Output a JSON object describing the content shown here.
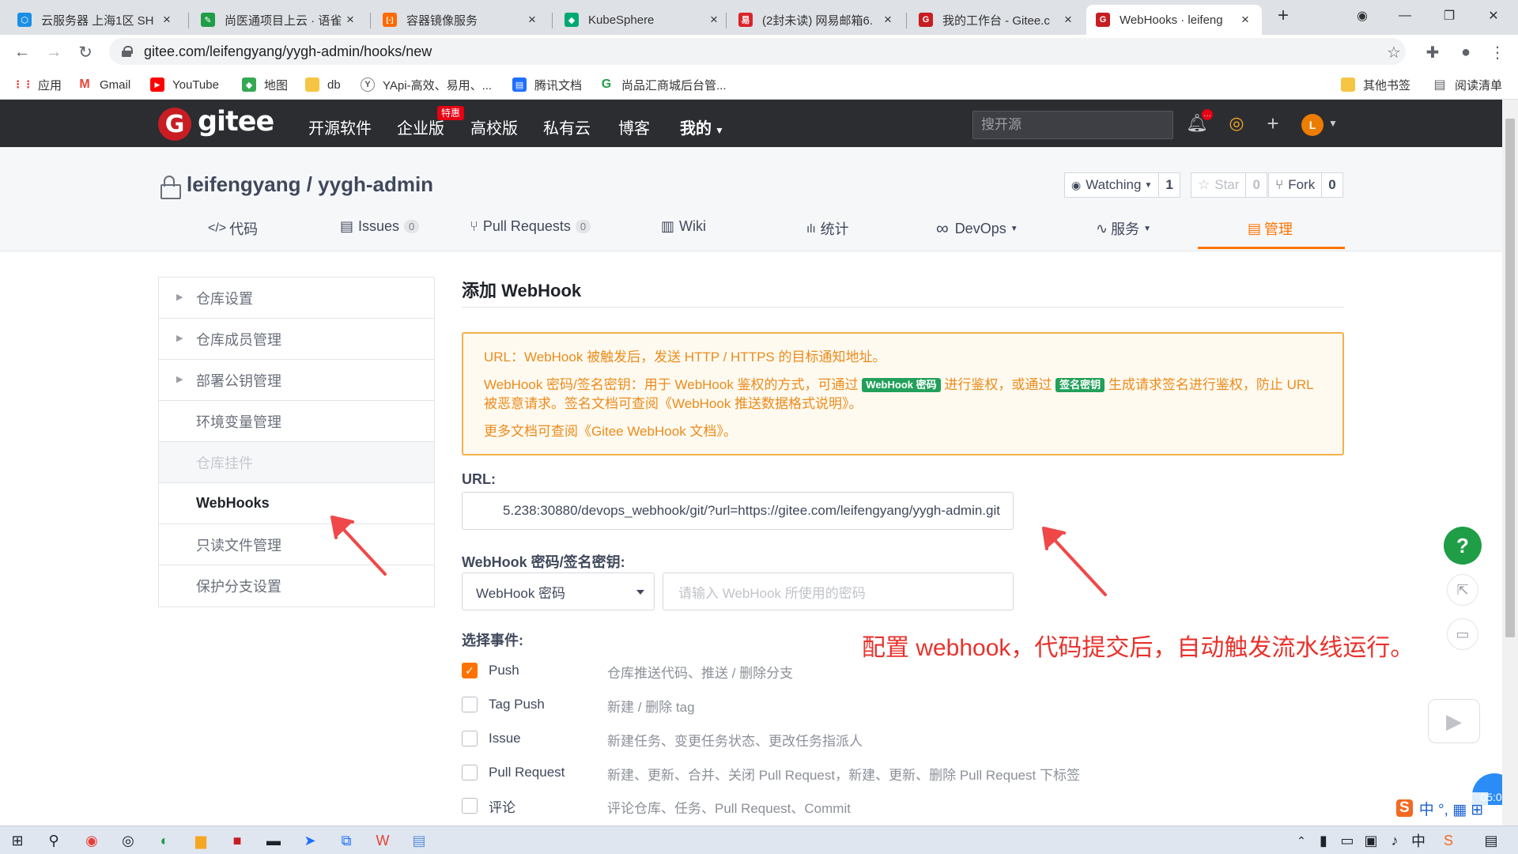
{
  "browser": {
    "tabs": [
      {
        "label": "云服务器 上海1区 SH",
        "favicon_color": "#1b8fe6",
        "favicon_glyph": "⬡"
      },
      {
        "label": "尚医通项目上云 · 语雀",
        "favicon_color": "#1f9d47",
        "favicon_glyph": "✎"
      },
      {
        "label": "容器镜像服务",
        "favicon_color": "#ff6a00",
        "favicon_glyph": "[-]"
      },
      {
        "label": "KubeSphere",
        "favicon_color": "#00a971",
        "favicon_glyph": "◆"
      },
      {
        "label": "(2封未读) 网易邮箱6.",
        "favicon_color": "#d9252a",
        "favicon_glyph": "易"
      },
      {
        "label": "我的工作台 - Gitee.c",
        "favicon_color": "#c71d23",
        "favicon_glyph": "G"
      },
      {
        "label": "WebHooks · leifeng",
        "favicon_color": "#c71d23",
        "favicon_glyph": "G"
      }
    ],
    "new_tab_glyph": "+",
    "url": "gitee.com/leifengyang/yygh-admin/hooks/new",
    "bookmarks": [
      {
        "label": "应用",
        "icon_color": "#e53935",
        "glyph": "⋮⋮"
      },
      {
        "label": "Gmail",
        "icon_color": "#ea4335",
        "glyph": "M"
      },
      {
        "label": "YouTube",
        "icon_color": "#ff0000",
        "glyph": "▶"
      },
      {
        "label": "地图",
        "icon_color": "#34a853",
        "glyph": "◆"
      },
      {
        "label": "db",
        "icon_color": "#f6c544",
        "glyph": ""
      },
      {
        "label": "YApi-高效、易用、...",
        "icon_color": "#555555",
        "glyph": "Y"
      },
      {
        "label": "腾讯文档",
        "icon_color": "#1e6fff",
        "glyph": "▤"
      },
      {
        "label": "尚品汇商城后台管...",
        "icon_color": "#1f9d47",
        "glyph": "G"
      },
      {
        "label": "其他书签",
        "icon_color": "#f6c544",
        "glyph": ""
      },
      {
        "label": "阅读清单",
        "icon_color": "#5f6368",
        "glyph": "▤"
      }
    ]
  },
  "gitee": {
    "logo_glyph": "G",
    "logo_text": "gitee",
    "nav": [
      "开源软件",
      "企业版",
      "高校版",
      "私有云",
      "博客",
      "我的"
    ],
    "hot_badge": "特惠",
    "search_placeholder": "搜开源",
    "notification_badge": "…",
    "avatar_initial": "L"
  },
  "repo": {
    "title": "leifengyang / yygh-admin",
    "watching_label": "Watching",
    "watching_count": "1",
    "star_label": "Star",
    "star_count": "0",
    "fork_label": "Fork",
    "fork_count": "0",
    "tabs": [
      {
        "icon": "</>",
        "label": "代码"
      },
      {
        "icon": "▤",
        "label": "Issues",
        "badge": "0"
      },
      {
        "icon": "⑂",
        "label": "Pull Requests",
        "badge": "0"
      },
      {
        "icon": "▥",
        "label": "Wiki"
      },
      {
        "icon": "ılı",
        "label": "统计"
      },
      {
        "icon": "∞",
        "label": "DevOps"
      },
      {
        "icon": "∿",
        "label": "服务"
      },
      {
        "icon": "▤",
        "label": "管理"
      }
    ]
  },
  "sidebar": {
    "items": [
      {
        "label": "仓库设置"
      },
      {
        "label": "仓库成员管理"
      },
      {
        "label": "部署公钥管理"
      },
      {
        "label": "环境变量管理"
      },
      {
        "label": "仓库挂件"
      },
      {
        "label": "WebHooks"
      },
      {
        "label": "只读文件管理"
      },
      {
        "label": "保护分支设置"
      }
    ]
  },
  "form": {
    "title": "添加 WebHook",
    "notice": {
      "line1": "URL：WebHook 被触发后，发送 HTTP / HTTPS 的目标通知地址。",
      "line2_a": "WebHook 密码/签名密钥：用于 WebHook 鉴权的方式，可通过",
      "chip1": "WebHook 密码",
      "line2_b": "进行鉴权，或通过",
      "chip2": "签名密钥",
      "line2_c": "生成请求签名进行鉴权，防止 URL 被恶意请求。签名文档可查阅《WebHook 推送数据格式说明》。",
      "line3": "更多文档可查阅《Gitee WebHook 文档》。"
    },
    "url_label": "URL:",
    "url_value": "5.238:30880/devops_webhook/git/?url=https://gitee.com/leifengyang/yygh-admin.git",
    "secret_label": "WebHook 密码/签名密钥:",
    "secret_type": "WebHook 密码",
    "secret_placeholder": "请输入 WebHook 所使用的密码",
    "events_label": "选择事件:",
    "events": [
      {
        "label": "Push",
        "desc": "仓库推送代码、推送 / 删除分支",
        "checked": true
      },
      {
        "label": "Tag Push",
        "desc": "新建 / 删除 tag",
        "checked": false
      },
      {
        "label": "Issue",
        "desc": "新建任务、变更任务状态、更改任务指派人",
        "checked": false
      },
      {
        "label": "Pull Request",
        "desc": "新建、更新、合并、关闭 Pull Request，新建、更新、删除 Pull Request 下标签",
        "checked": false
      },
      {
        "label": "评论",
        "desc": "评论仓库、任务、Pull Request、Commit",
        "checked": false
      }
    ],
    "check_glyph": "✓"
  },
  "annotation": "配置 webhook，代码提交后，自动触发流水线运行。",
  "floating": {
    "help_glyph": "?",
    "time": "05:08"
  },
  "ime": {
    "text": "中 °, ▦ ⊞"
  },
  "colors": {
    "accent": "#fe7300",
    "gitee_red": "#c71d23",
    "annotation_red": "#e8322c",
    "notice_border": "#f3b14a",
    "chip_green": "#22a05a"
  }
}
